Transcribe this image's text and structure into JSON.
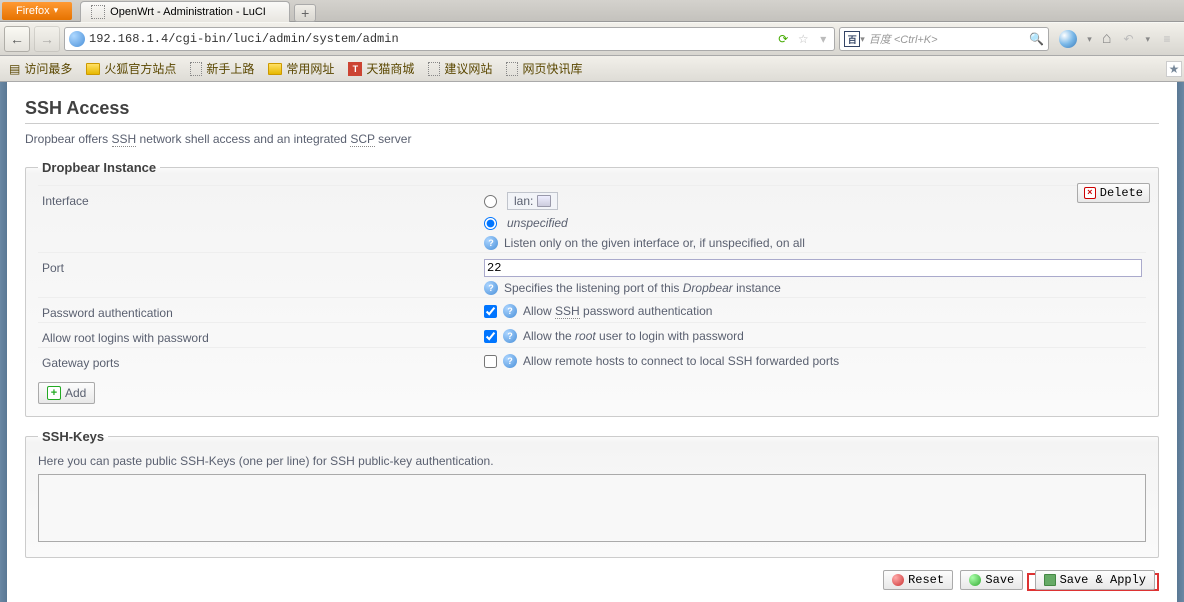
{
  "browser": {
    "firefox_label": "Firefox",
    "tab_title": "OpenWrt - Administration - LuCI",
    "url": "192.168.1.4/cgi-bin/luci/admin/system/admin",
    "search_placeholder": "百度 <Ctrl+K>"
  },
  "bookmarks": {
    "most": "访问最多",
    "fox": "火狐官方站点",
    "newbie": "新手上路",
    "common": "常用网址",
    "tmall_icon": "T",
    "tmall": "天猫商城",
    "suggest": "建议网站",
    "quick": "网页快讯库"
  },
  "page": {
    "h2": "SSH Access",
    "desc_pre": "Dropbear offers ",
    "desc_ssh": "SSH",
    "desc_mid": " network shell access and an integrated ",
    "desc_scp": "SCP",
    "desc_post": " server"
  },
  "instance": {
    "legend": "Dropbear Instance",
    "delete": "Delete",
    "iface_label": "Interface",
    "lan": "lan:",
    "unspecified": "unspecified",
    "iface_hint": "Listen only on the given interface or, if unspecified, on all",
    "port_label": "Port",
    "port_value": "22",
    "port_hint_pre": "Specifies the listening port of this ",
    "port_hint_em": "Dropbear",
    "port_hint_post": " instance",
    "pwauth_label": "Password authentication",
    "pwauth_hint_pre": "Allow ",
    "pwauth_hint_u": "SSH",
    "pwauth_hint_post": " password authentication",
    "root_label": "Allow root logins with password",
    "root_hint_pre": "Allow the ",
    "root_hint_em": "root",
    "root_hint_post": " user to login with password",
    "gw_label": "Gateway ports",
    "gw_hint": "Allow remote hosts to connect to local SSH forwarded ports",
    "add": "Add"
  },
  "sshkeys": {
    "legend": "SSH-Keys",
    "desc": "Here you can paste public SSH-Keys (one per line) for SSH public-key authentication."
  },
  "actions": {
    "reset": "Reset",
    "save": "Save",
    "save_apply": "Save & Apply"
  }
}
